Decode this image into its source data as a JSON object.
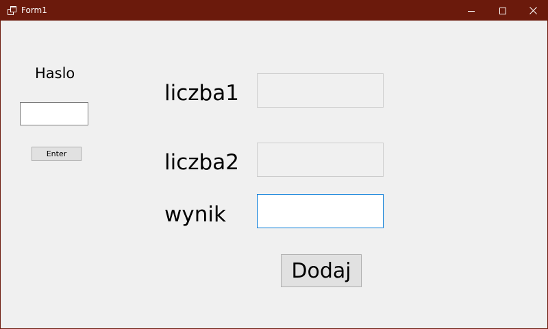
{
  "window": {
    "title": "Form1",
    "title_bar_color": "#6b1a0c",
    "background_color": "#f0f0f0"
  },
  "login": {
    "password_label": "Haslo",
    "password_value": "",
    "enter_button": "Enter"
  },
  "calculator": {
    "number1_label": "liczba1",
    "number1_value": "",
    "number2_label": "liczba2",
    "number2_value": "",
    "result_label": "wynik",
    "result_value": "",
    "add_button": "Dodaj"
  },
  "icons": {
    "app": "window-app-icon",
    "minimize": "minimize-icon",
    "maximize": "maximize-icon",
    "close": "close-icon"
  }
}
